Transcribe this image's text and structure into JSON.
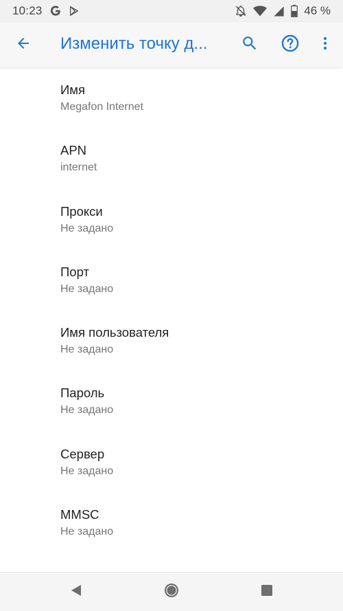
{
  "status_bar": {
    "time": "10:23",
    "battery_text": "46 %",
    "left_icons": [
      "google-g-icon",
      "play-store-icon"
    ],
    "right_icons": [
      "notifications-off-icon",
      "wifi-icon",
      "signal-icon",
      "battery-icon"
    ]
  },
  "app_bar": {
    "title": "Изменить точку д...",
    "accent_color": "#1e75d6",
    "icons": [
      "back-arrow-icon",
      "search-icon",
      "help-icon",
      "more-vert-icon"
    ]
  },
  "settings": [
    {
      "title": "Имя",
      "summary": "Megafon Internet"
    },
    {
      "title": "APN",
      "summary": "internet"
    },
    {
      "title": "Прокси",
      "summary": "Не задано"
    },
    {
      "title": "Порт",
      "summary": "Не задано"
    },
    {
      "title": "Имя пользователя",
      "summary": "Не задано"
    },
    {
      "title": "Пароль",
      "summary": "Не задано"
    },
    {
      "title": "Сервер",
      "summary": "Не задано"
    },
    {
      "title": "MMSC",
      "summary": "Не задано"
    }
  ],
  "nav_bar": {
    "icons": [
      "back-triangle-icon",
      "home-circle-icon",
      "recents-square-icon"
    ]
  }
}
